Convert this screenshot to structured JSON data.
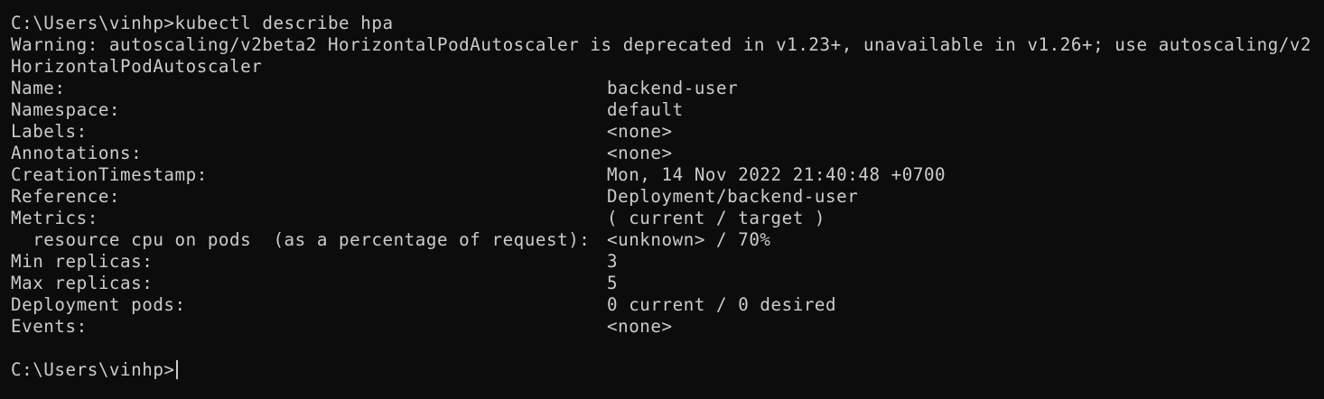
{
  "terminal": {
    "command_line": "C:\\Users\\vinhp>kubectl describe hpa",
    "warning_line1": "Warning: autoscaling/v2beta2 HorizontalPodAutoscaler is deprecated in v1.23+, unavailable in v1.26+; use autoscaling/v2",
    "warning_line2": "HorizontalPodAutoscaler",
    "rows": [
      {
        "key": "Name:",
        "value": "backend-user"
      },
      {
        "key": "Namespace:",
        "value": "default"
      },
      {
        "key": "Labels:",
        "value": "<none>"
      },
      {
        "key": "Annotations:",
        "value": "<none>"
      },
      {
        "key": "CreationTimestamp:",
        "value": "Mon, 14 Nov 2022 21:40:48 +0700"
      },
      {
        "key": "Reference:",
        "value": "Deployment/backend-user"
      },
      {
        "key": "Metrics:",
        "value": "( current / target )"
      },
      {
        "key": "  resource cpu on pods  (as a percentage of request):",
        "value": "<unknown> / 70%"
      },
      {
        "key": "Min replicas:",
        "value": "3"
      },
      {
        "key": "Max replicas:",
        "value": "5"
      },
      {
        "key": "Deployment pods:",
        "value": "0 current / 0 desired"
      },
      {
        "key": "Events:",
        "value": "<none>"
      }
    ],
    "prompt": "C:\\Users\\vinhp>"
  }
}
